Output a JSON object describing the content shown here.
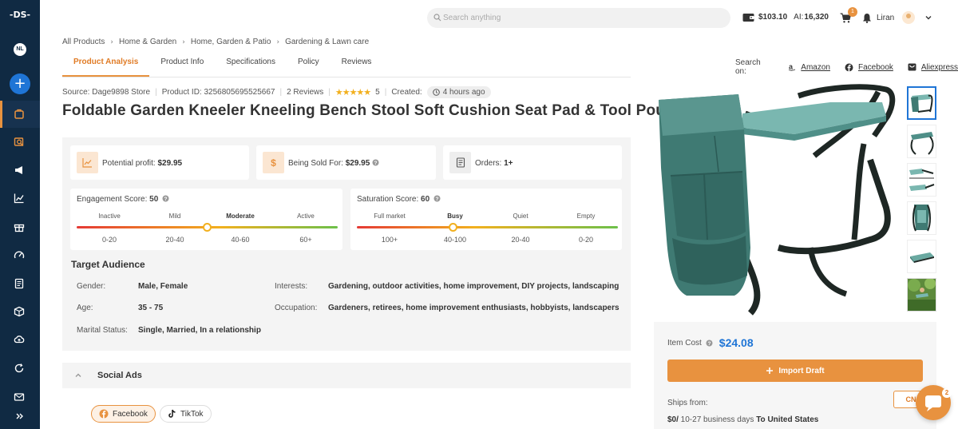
{
  "sidebar": {
    "logo": "-DS-",
    "workspace": "NL",
    "add_label": "+",
    "items": [
      "products-icon",
      "product-research-icon",
      "ads-icon",
      "analytics-icon",
      "gift-icon",
      "speed-icon",
      "document-icon",
      "box-icon",
      "cloud-upload-icon",
      "sync-icon",
      "mail-icon",
      "expand-icon"
    ]
  },
  "header": {
    "search_placeholder": "Search anything",
    "wallet_balance": "$103.10",
    "ai_label": "AI:",
    "ai_credits": "16,320",
    "cart_count": "1",
    "user_name": "Liran"
  },
  "breadcrumb": [
    "All Products",
    "Home & Garden",
    "Home, Garden & Patio",
    "Gardening & Lawn care"
  ],
  "tabs": [
    "Product Analysis",
    "Product Info",
    "Specifications",
    "Policy",
    "Reviews"
  ],
  "search_on": {
    "label": "Search on:",
    "links": [
      "Amazon",
      "Facebook",
      "Aliexpress"
    ]
  },
  "meta": {
    "source": "Source: Dage9898 Store",
    "product_id": "Product ID: 3256805695525667",
    "reviews": "2 Reviews",
    "rating": "5",
    "created_label": "Created:",
    "created_value": "4 hours ago"
  },
  "product_title": "Foldable Garden Kneeler Kneeling Bench Stool Soft Cushion Seat Pad & Tool Pouch",
  "metrics": {
    "profit_label": "Potential profit:",
    "profit_value": "$29.95",
    "sold_label": "Being Sold For:",
    "sold_value": "$29.95",
    "orders_label": "Orders:",
    "orders_value": "1+"
  },
  "engagement": {
    "label": "Engagement Score:",
    "value": "50",
    "levels": [
      "Inactive",
      "Mild",
      "Moderate",
      "Active"
    ],
    "ranges": [
      "0-20",
      "20-40",
      "40-60",
      "60+"
    ],
    "active_index": 2,
    "score_fraction": 0.5
  },
  "saturation": {
    "label": "Saturation Score:",
    "value": "60",
    "levels": [
      "Full market",
      "Busy",
      "Quiet",
      "Empty"
    ],
    "ranges": [
      "100+",
      "40-100",
      "20-40",
      "0-20"
    ],
    "active_index": 1,
    "score_fraction": 0.37
  },
  "target_audience": {
    "title": "Target Audience",
    "gender_label": "Gender:",
    "gender": "Male, Female",
    "age_label": "Age:",
    "age": "35 - 75",
    "marital_label": "Marital Status:",
    "marital": "Single, Married, In a relationship",
    "interests_label": "Interests:",
    "interests": "Gardening, outdoor activities, home improvement, DIY projects, landscaping",
    "occupation_label": "Occupation:",
    "occupation": "Gardeners, retirees, home improvement enthusiasts, hobbyists, landscapers"
  },
  "social_ads": {
    "title": "Social Ads",
    "chips": [
      "Facebook",
      "TikTok"
    ]
  },
  "purchase": {
    "item_cost_label": "Item Cost",
    "item_cost": "$24.08",
    "import_label": "Import Draft",
    "ships_from_label": "Ships from:",
    "ship_country": "CN",
    "shipping_price": "$0/",
    "shipping_days": " 10-27 business days ",
    "shipping_destination": "To United States"
  },
  "chat_badge": "2",
  "colors": {
    "sidebar": "#102a43",
    "accent": "#e8923f",
    "link_blue": "#1f75d6",
    "product_green": "#3f8a84"
  }
}
